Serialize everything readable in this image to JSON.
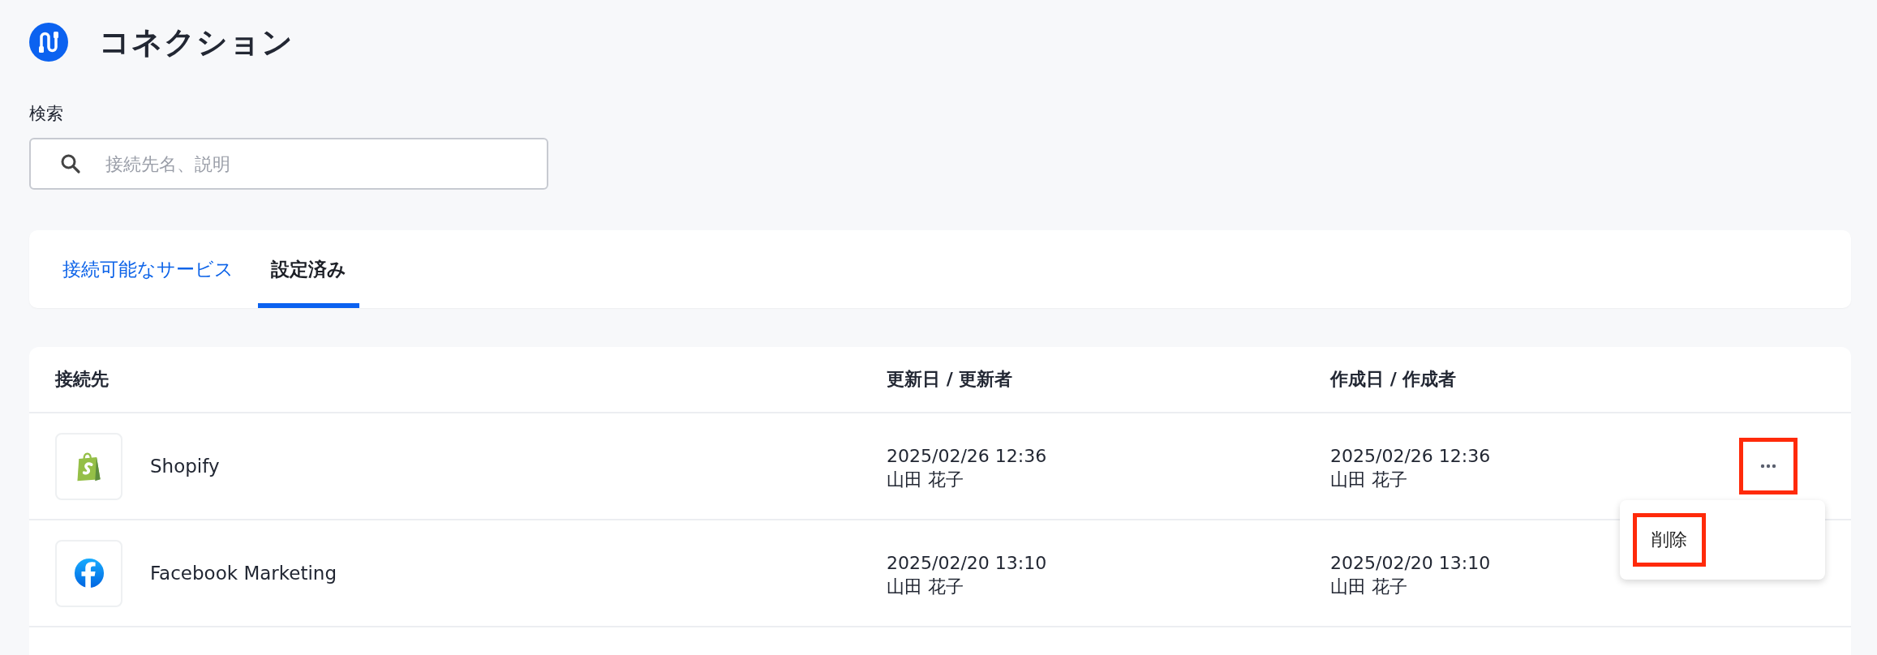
{
  "page": {
    "title": "コネクション"
  },
  "search": {
    "label": "検索",
    "placeholder": "接続先名、説明"
  },
  "tabs": [
    {
      "label": "接続可能なサービス",
      "selected": false
    },
    {
      "label": "設定済み",
      "selected": true
    }
  ],
  "table": {
    "columns": [
      "接続先",
      "更新日 / 更新者",
      "作成日 / 作成者"
    ],
    "rows": [
      {
        "kind": "shopify",
        "name": "Shopify",
        "updated": "2025/02/26 12:36",
        "updated_by": "山田 花子",
        "created": "2025/02/26 12:36",
        "created_by": "山田 花子",
        "more_button": {
          "highlighted": true
        }
      },
      {
        "kind": "facebook",
        "name": "Facebook Marketing",
        "updated": "2025/02/20 13:10",
        "updated_by": "山田 花子",
        "created": "2025/02/20 13:10",
        "created_by": "山田 花子"
      }
    ]
  },
  "row_menu": {
    "items": [
      {
        "label": "削除",
        "highlighted": true
      }
    ]
  }
}
